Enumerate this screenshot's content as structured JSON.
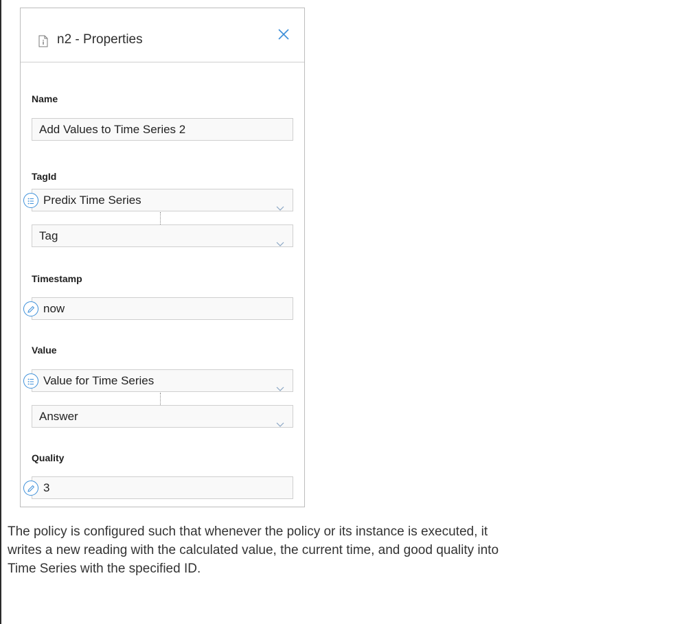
{
  "panel": {
    "title": "n2 - Properties",
    "fields": {
      "name": {
        "label": "Name",
        "value": "Add Values to Time Series 2"
      },
      "tagid": {
        "label": "TagId",
        "source": "Predix Time Series",
        "item": "Tag"
      },
      "timestamp": {
        "label": "Timestamp",
        "value": "now"
      },
      "value": {
        "label": "Value",
        "source": "Value for Time Series",
        "item": "Answer"
      },
      "quality": {
        "label": "Quality",
        "value": "3"
      }
    }
  },
  "description": {
    "lines": [
      "The policy is configured such that whenever the policy or its instance is executed, it",
      "writes a new reading with the calculated value, the current time, and good quality into",
      "Time Series with the specified ID."
    ]
  },
  "colors": {
    "accent": "#3c8fd9",
    "border": "#cfcfcf",
    "field_bg": "#f9f9f9"
  }
}
